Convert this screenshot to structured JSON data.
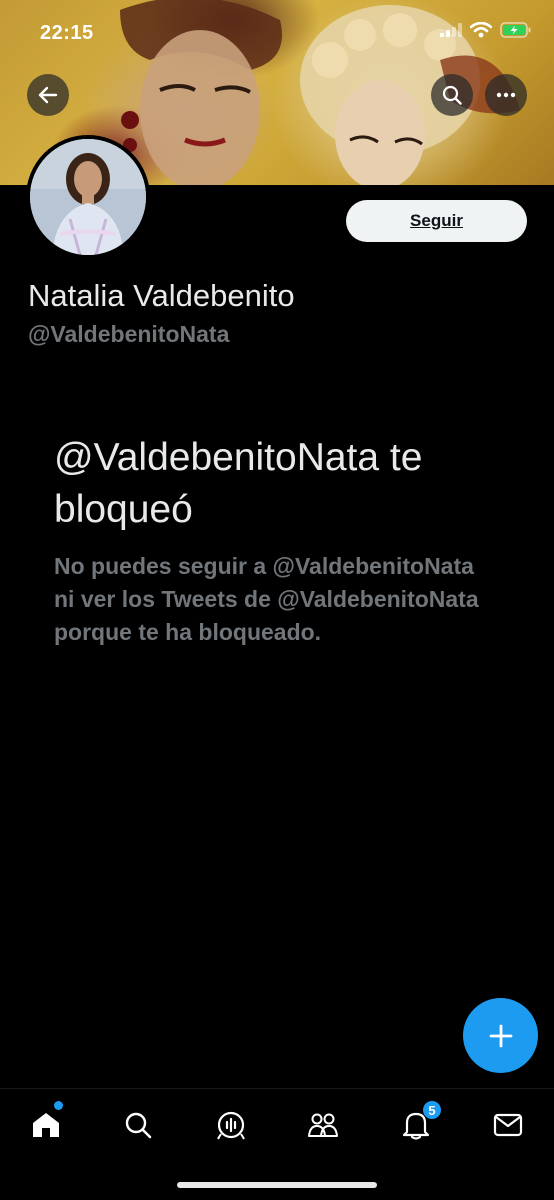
{
  "status_bar": {
    "time": "22:15"
  },
  "profile": {
    "display_name": "Natalia Valdebenito",
    "handle": "@ValdebenitoNata",
    "follow_label": "Seguir"
  },
  "blocked": {
    "title": "@ValdebenitoNata te bloqueó",
    "message": "No puedes seguir a @ValdebenitoNata ni ver los Tweets de @ValdebenitoNata porque te ha bloqueado."
  },
  "nav": {
    "items": [
      "home-icon",
      "search-icon",
      "spaces-icon",
      "communities-icon",
      "notifications-icon",
      "messages-icon"
    ],
    "notifications_badge": "5"
  },
  "colors": {
    "accent": "#1d9bf0",
    "background": "#000000",
    "secondary_text": "#71767b"
  }
}
